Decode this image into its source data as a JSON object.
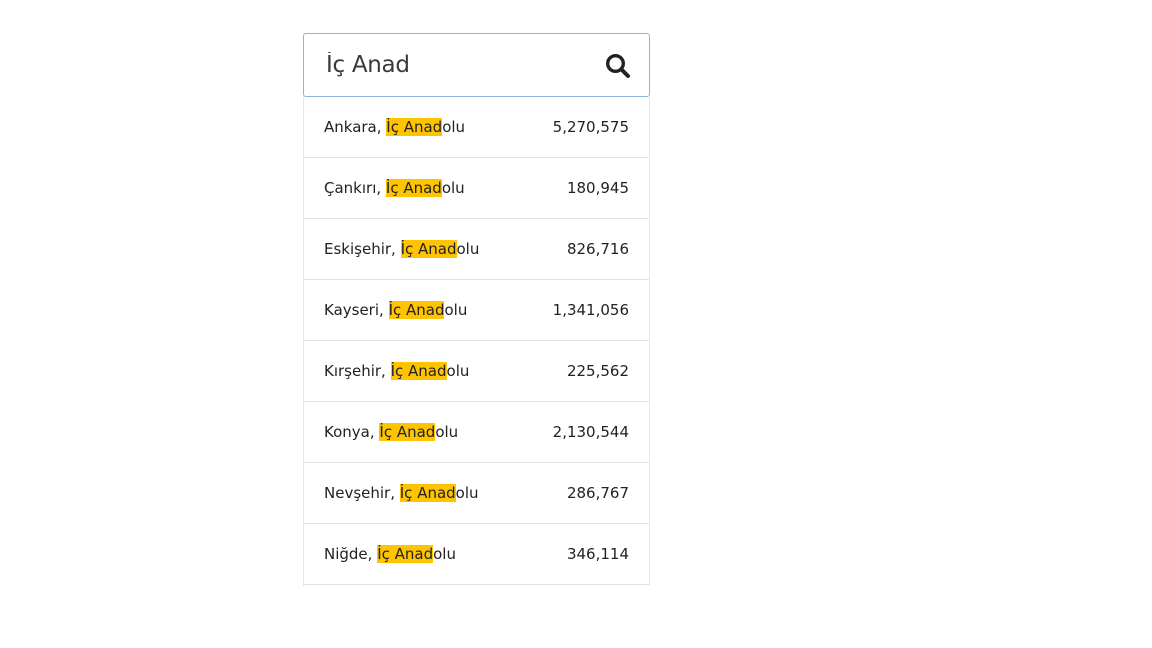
{
  "search": {
    "value": "İç Anad",
    "icon": "search-icon"
  },
  "colors": {
    "highlight": "#ffc400",
    "border": "#8fb3d9"
  },
  "results": [
    {
      "city": "Ankara, ",
      "match": "İç Anad",
      "rest": "olu",
      "population": "5,270,575"
    },
    {
      "city": "Çankırı, ",
      "match": "İç Anad",
      "rest": "olu",
      "population": "180,945"
    },
    {
      "city": "Eskişehir, ",
      "match": "İç Anad",
      "rest": "olu",
      "population": "826,716"
    },
    {
      "city": "Kayseri, ",
      "match": "İç Anad",
      "rest": "olu",
      "population": "1,341,056"
    },
    {
      "city": "Kırşehir, ",
      "match": "İç Anad",
      "rest": "olu",
      "population": "225,562"
    },
    {
      "city": "Konya, ",
      "match": "İç Anad",
      "rest": "olu",
      "population": "2,130,544"
    },
    {
      "city": "Nevşehir, ",
      "match": "İç Anad",
      "rest": "olu",
      "population": "286,767"
    },
    {
      "city": "Niğde, ",
      "match": "İç Anad",
      "rest": "olu",
      "population": "346,114"
    }
  ]
}
